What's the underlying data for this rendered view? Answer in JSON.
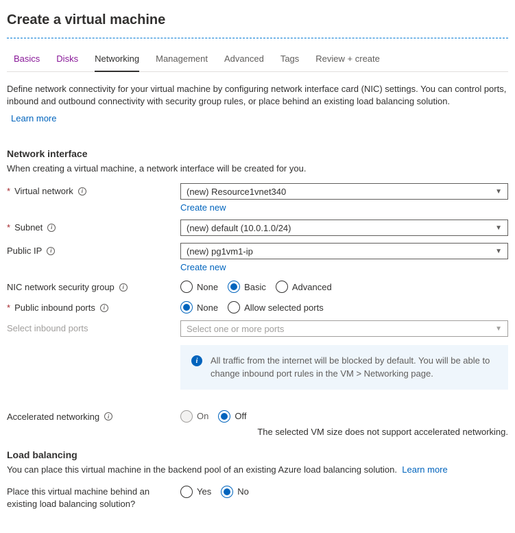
{
  "title": "Create a virtual machine",
  "tabs": {
    "basics": "Basics",
    "disks": "Disks",
    "networking": "Networking",
    "management": "Management",
    "advanced": "Advanced",
    "tags": "Tags",
    "review": "Review + create"
  },
  "intro": {
    "text": "Define network connectivity for your virtual machine by configuring network interface card (NIC) settings. You can control ports, inbound and outbound connectivity with security group rules, or place behind an existing load balancing solution.",
    "learn_more": "Learn more"
  },
  "ni": {
    "heading": "Network interface",
    "desc": "When creating a virtual machine, a network interface will be created for you.",
    "vnet": {
      "label": "Virtual network",
      "value": "(new) Resource1vnet340",
      "create": "Create new"
    },
    "subnet": {
      "label": "Subnet",
      "value": "(new) default (10.0.1.0/24)"
    },
    "pip": {
      "label": "Public IP",
      "value": "(new) pg1vm1-ip",
      "create": "Create new"
    },
    "nsg": {
      "label": "NIC network security group",
      "options": {
        "none": "None",
        "basic": "Basic",
        "advanced": "Advanced"
      }
    },
    "pports": {
      "label": "Public inbound ports",
      "options": {
        "none": "None",
        "allow": "Allow selected ports"
      }
    },
    "sports": {
      "label": "Select inbound ports",
      "placeholder": "Select one or more ports"
    },
    "info": "All traffic from the internet will be blocked by default. You will be able to change inbound port rules in the VM > Networking page.",
    "accel": {
      "label": "Accelerated networking",
      "options": {
        "on": "On",
        "off": "Off"
      },
      "helper": "The selected VM size does not support accelerated networking."
    }
  },
  "lb": {
    "heading": "Load balancing",
    "desc": "You can place this virtual machine in the backend pool of an existing Azure load balancing solution.",
    "learn_more": "Learn more",
    "place": {
      "label": "Place this virtual machine behind an existing load balancing solution?",
      "options": {
        "yes": "Yes",
        "no": "No"
      }
    }
  }
}
